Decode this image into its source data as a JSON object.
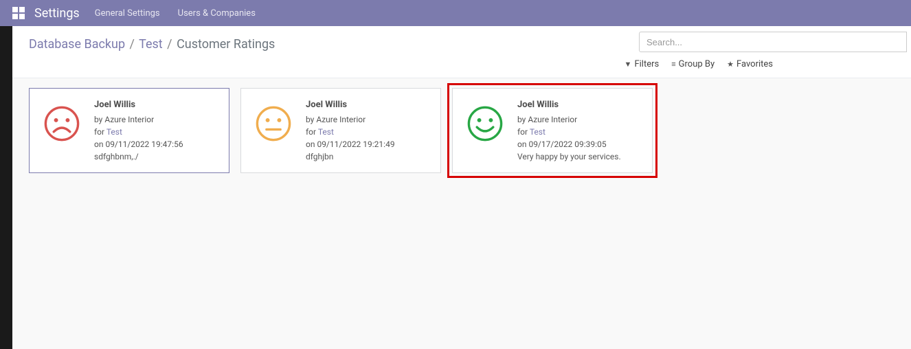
{
  "topbar": {
    "brand": "Settings",
    "links": [
      "General Settings",
      "Users & Companies"
    ]
  },
  "breadcrumb": {
    "items": [
      "Database Backup",
      "Test"
    ],
    "current": "Customer Ratings"
  },
  "search": {
    "placeholder": "Search..."
  },
  "toolbar": {
    "filters": "Filters",
    "group_by": "Group By",
    "favorites": "Favorites"
  },
  "cards": [
    {
      "name": "Joel Willis",
      "by": "by Azure Interior",
      "for_prefix": "for ",
      "for_link": "Test",
      "date": "on 09/11/2022 19:47:56",
      "comment": "sdfghbnm,./",
      "mood": "sad",
      "color": "#d9534f",
      "selected": true,
      "highlighted": false
    },
    {
      "name": "Joel Willis",
      "by": "by Azure Interior",
      "for_prefix": "for ",
      "for_link": "Test",
      "date": "on 09/11/2022 19:21:49",
      "comment": "dfghjbn",
      "mood": "neutral",
      "color": "#f0ad4e",
      "selected": false,
      "highlighted": false
    },
    {
      "name": "Joel Willis",
      "by": "by Azure Interior",
      "for_prefix": "for ",
      "for_link": "Test",
      "date": "on 09/17/2022 09:39:05",
      "comment": "Very happy by your services.",
      "mood": "happy",
      "color": "#28a745",
      "selected": false,
      "highlighted": true
    }
  ]
}
